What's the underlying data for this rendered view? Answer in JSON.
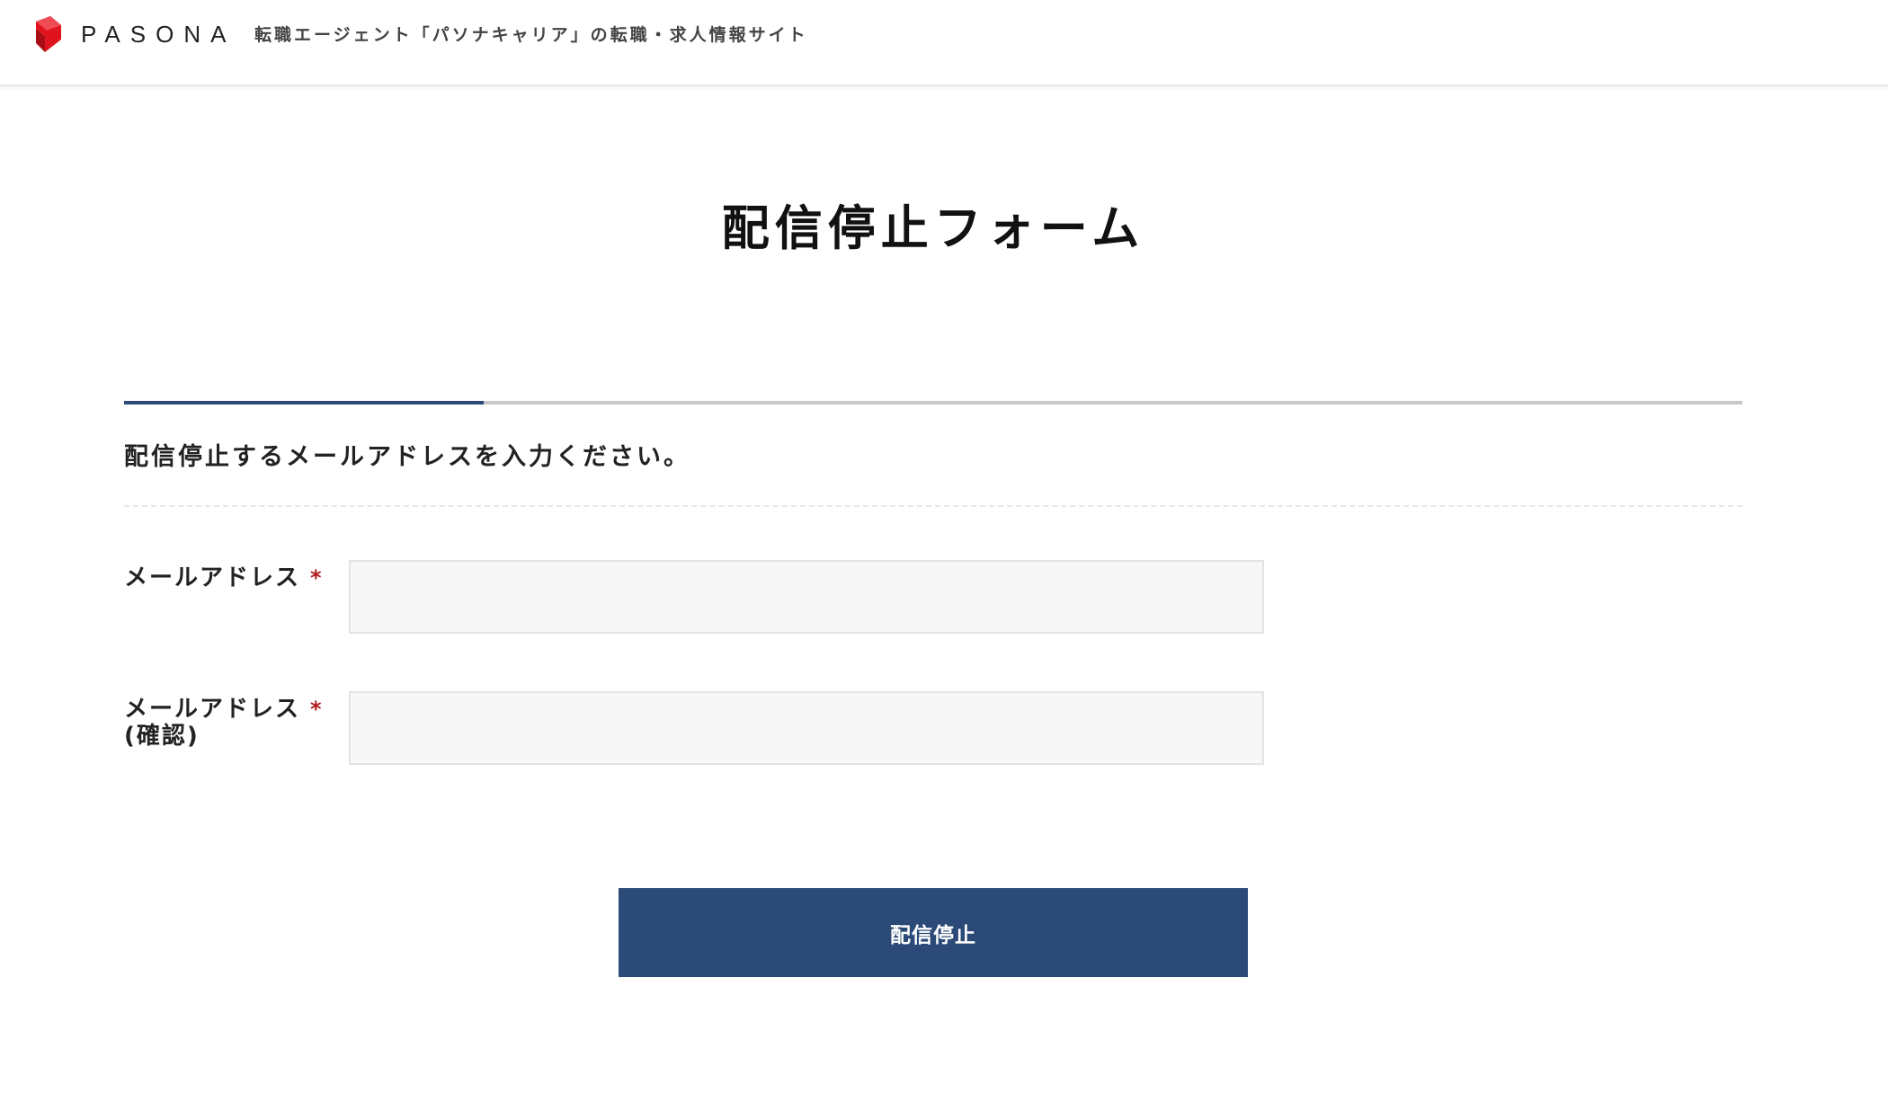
{
  "header": {
    "logo_text": "PASONA",
    "tagline": "転職エージェント「パソナキャリア」の転職・求人情報サイト",
    "brand_color": "#e0141e"
  },
  "page": {
    "title": "配信停止フォーム"
  },
  "progress": {
    "fraction": 0.222,
    "fill_color": "#2b4a78",
    "track_color": "#c8c8c8"
  },
  "form": {
    "instruction": "配信停止するメールアドレスを入力ください。",
    "required_mark": "*",
    "email": {
      "label": "メールアドレス",
      "value": "",
      "placeholder": ""
    },
    "email_confirm": {
      "label_line1": "メールアドレス",
      "label_line2": "(確認)",
      "value": "",
      "placeholder": ""
    },
    "submit_label": "配信停止",
    "accent_color": "#2b4a78",
    "required_color": "#b01b1b"
  }
}
